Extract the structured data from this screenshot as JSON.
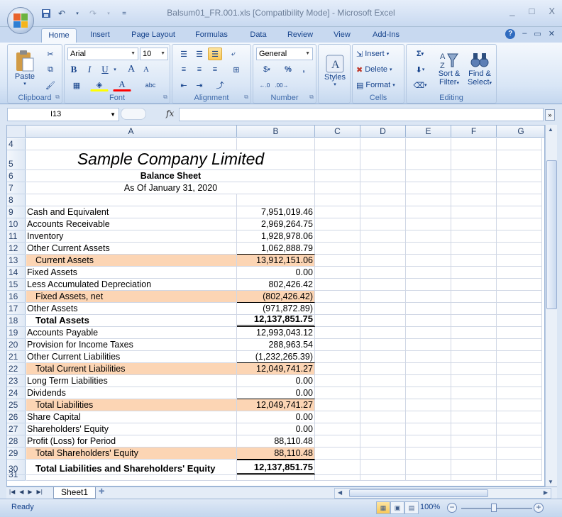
{
  "window": {
    "title": "Balsum01_FR.001.xls  [Compatibility Mode] - Microsoft Excel",
    "minimize": "_",
    "maximize": "□",
    "close": "X"
  },
  "quick_access": {
    "save_icon": "save-icon",
    "undo_icon": "undo-icon",
    "redo_icon": "redo-icon",
    "customize": "="
  },
  "tabs": [
    "Home",
    "Insert",
    "Page Layout",
    "Formulas",
    "Data",
    "Review",
    "View",
    "Add-Ins"
  ],
  "active_tab": "Home",
  "ribbon": {
    "clipboard": {
      "label": "Clipboard",
      "paste": "Paste"
    },
    "font": {
      "label": "Font",
      "font_name": "Arial",
      "font_size": "10",
      "bold": "B",
      "italic": "I",
      "underline": "U",
      "grow": "A",
      "shrink": "A",
      "font_color": "A",
      "abc": "abc"
    },
    "alignment": {
      "label": "Alignment"
    },
    "number": {
      "label": "Number",
      "format": "General",
      "percent": "%",
      "comma": ",",
      "currency": "$"
    },
    "styles": {
      "label": "Styles"
    },
    "cells": {
      "label": "Cells",
      "insert": "Insert",
      "delete": "Delete",
      "format": "Format"
    },
    "editing": {
      "label": "Editing",
      "sigma": "Σ",
      "sort_filter": "Sort &",
      "sort_filter2": "Filter",
      "find_select": "Find &",
      "find_select2": "Select"
    }
  },
  "formula_bar": {
    "name_box": "I13",
    "fx": "fx",
    "expand": "»",
    "formula": ""
  },
  "columns": [
    "A",
    "B",
    "C",
    "D",
    "E",
    "F",
    "G"
  ],
  "rows": [
    {
      "num": "4",
      "a": "",
      "b": ""
    },
    {
      "num": "5",
      "a": "Sample Company Limited",
      "b": ""
    },
    {
      "num": "6",
      "a": "Balance Sheet",
      "b": ""
    },
    {
      "num": "7",
      "a": "As Of January 31, 2020",
      "b": ""
    },
    {
      "num": "8",
      "a": "",
      "b": ""
    },
    {
      "num": "9",
      "a": "Cash and Equivalent",
      "b": "7,951,019.46"
    },
    {
      "num": "10",
      "a": "Accounts Receivable",
      "b": "2,969,264.75"
    },
    {
      "num": "11",
      "a": "Inventory",
      "b": "1,928,978.06"
    },
    {
      "num": "12",
      "a": "Other Current Assets",
      "b": "1,062,888.79"
    },
    {
      "num": "13",
      "a": "Current Assets",
      "b": "13,912,151.06"
    },
    {
      "num": "14",
      "a": "Fixed Assets",
      "b": "0.00"
    },
    {
      "num": "15",
      "a": "Less Accumulated Depreciation",
      "b": "802,426.42"
    },
    {
      "num": "16",
      "a": "Fixed Assets, net",
      "b": "(802,426.42)"
    },
    {
      "num": "17",
      "a": "Other Assets",
      "b": "(971,872.89)"
    },
    {
      "num": "18",
      "a": "Total Assets",
      "b": "12,137,851.75"
    },
    {
      "num": "19",
      "a": "Accounts Payable",
      "b": "12,993,043.12"
    },
    {
      "num": "20",
      "a": "Provision for Income Taxes",
      "b": "288,963.54"
    },
    {
      "num": "21",
      "a": "Other Current Liabilities",
      "b": "(1,232,265.39)"
    },
    {
      "num": "22",
      "a": "Total Current Liabilities",
      "b": "12,049,741.27"
    },
    {
      "num": "23",
      "a": "Long Term Liabilities",
      "b": "0.00"
    },
    {
      "num": "24",
      "a": "Dividends",
      "b": "0.00"
    },
    {
      "num": "25",
      "a": "Total Liabilities",
      "b": "12,049,741.27"
    },
    {
      "num": "26",
      "a": "Share Capital",
      "b": "0.00"
    },
    {
      "num": "27",
      "a": "Shareholders' Equity",
      "b": "0.00"
    },
    {
      "num": "28",
      "a": "Profit (Loss) for Period",
      "b": "88,110.48"
    },
    {
      "num": "29",
      "a": "Total Shareholders' Equity",
      "b": "88,110.48"
    },
    {
      "num": "30",
      "a": "Total Liabilities and Shareholders' Equity",
      "b": "12,137,851.75"
    },
    {
      "num": "31",
      "a": "",
      "b": ""
    }
  ],
  "sheet_tabs": [
    "Sheet1"
  ],
  "status": {
    "ready": "Ready",
    "zoom": "100%",
    "zoom_minus": "−",
    "zoom_plus": "+"
  },
  "colors": {
    "subtotal_fill": "#fcd5b4",
    "ribbon_text": "#15428b"
  }
}
